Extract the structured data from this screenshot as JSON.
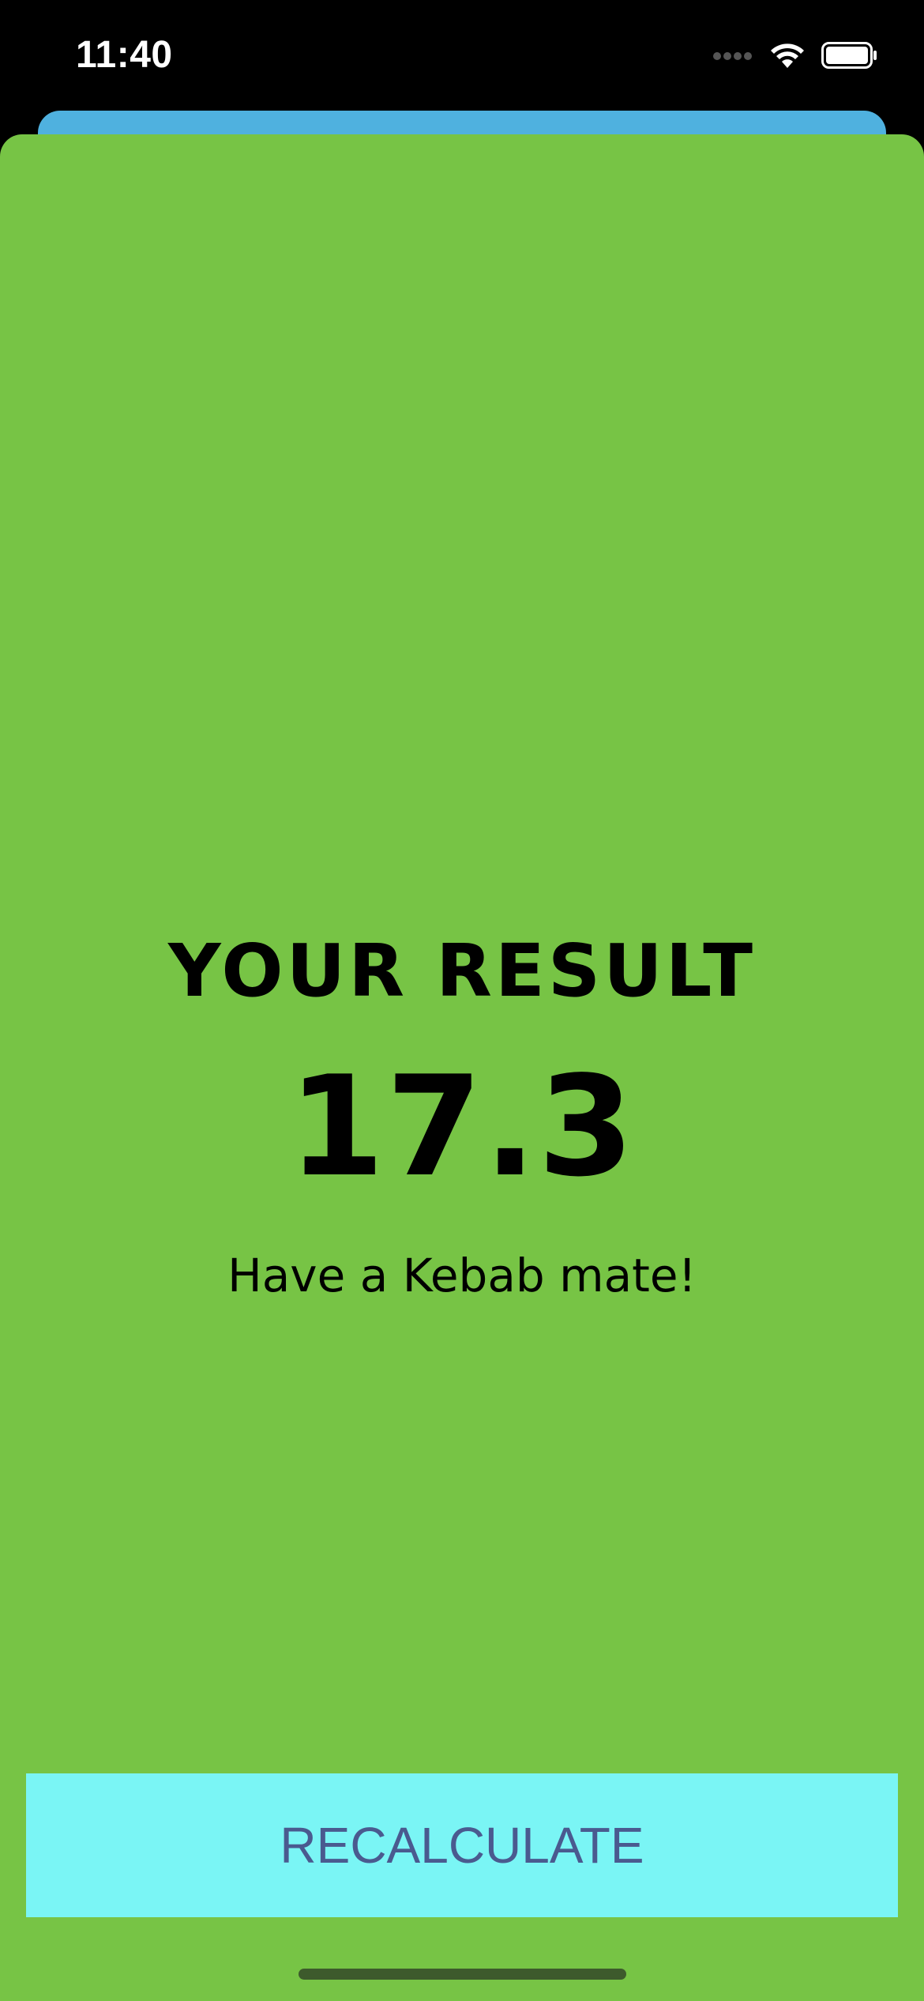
{
  "status_bar": {
    "time": "11:40",
    "icons": [
      "cellular-signal-icon",
      "wifi-icon",
      "battery-icon"
    ]
  },
  "colors": {
    "background_card": "#4fb1df",
    "result_sheet": "#77c445",
    "button_bg": "#7af5f5",
    "button_text": "#4a5a8f"
  },
  "result": {
    "title": "YOUR RESULT",
    "value": "17.3",
    "advice": "Have a Kebab mate!"
  },
  "actions": {
    "recalculate_label": "RECALCULATE"
  }
}
